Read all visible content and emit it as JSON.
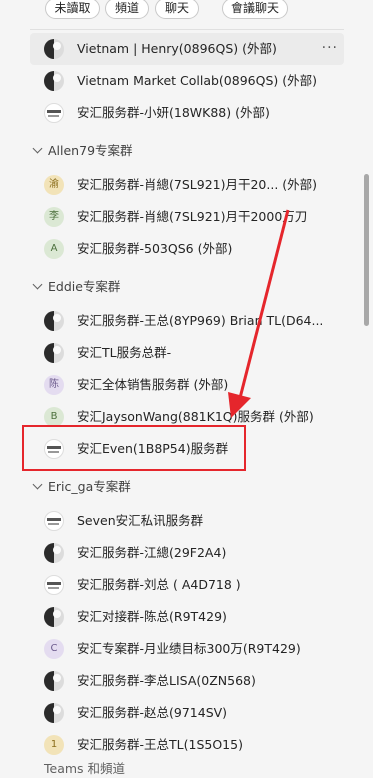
{
  "filters": [
    "未讀取",
    "頻道",
    "聊天",
    "會議聊天"
  ],
  "pinned": [
    {
      "label": "Vietnam | Henry(0896QS) (外部)",
      "avatar": "dark",
      "hover": true,
      "more": "···"
    },
    {
      "label": "Vietnam Market Collab(0896QS) (外部)",
      "avatar": "dark"
    },
    {
      "label": "安汇服务群-小妍(18WK88) (外部)",
      "avatar": "logo"
    }
  ],
  "groups": [
    {
      "name": "Allen79专案群",
      "items": [
        {
          "label": "安汇服务群-肖總(7SL921)月干20... (外部)",
          "avatar": "yellow",
          "avatar_text": "渝"
        },
        {
          "label": "安汇服务群-肖總(7SL921)月干2000万刀",
          "avatar": "green",
          "avatar_text": "李"
        },
        {
          "label": "安汇服务群-503QS6 (外部)",
          "avatar": "green",
          "avatar_text": "A"
        }
      ]
    },
    {
      "name": "Eddie专案群",
      "items": [
        {
          "label": "安汇服务群-王总(8YP969) Brian TL(D64...",
          "avatar": "dark"
        },
        {
          "label": "安汇TL服务总群-",
          "avatar": "dark"
        },
        {
          "label": "安汇全体销售服务群 (外部)",
          "avatar": "purple",
          "avatar_text": "陈"
        },
        {
          "label": "安汇JaysonWang(881K1Q)服务群 (外部)",
          "avatar": "green",
          "avatar_text": "B"
        },
        {
          "label": "安汇Even(1B8P54)服务群",
          "avatar": "logo"
        }
      ]
    },
    {
      "name": "Eric_ga专案群",
      "items": [
        {
          "label": "Seven安汇私讯服务群",
          "avatar": "logo"
        },
        {
          "label": "安汇服务群-江總(29F2A4)",
          "avatar": "dark"
        },
        {
          "label": "安汇服务群-刘总 ( A4D718 )",
          "avatar": "logo"
        },
        {
          "label": "安汇对接群-陈总(R9T429)",
          "avatar": "dark"
        },
        {
          "label": "安汇专案群-月业绩目标300万(R9T429)",
          "avatar": "purple",
          "avatar_text": "C"
        },
        {
          "label": "安汇服务群-李总LISA(0ZN568)",
          "avatar": "dark"
        },
        {
          "label": "安汇服务群-赵总(9714SV)",
          "avatar": "dark"
        },
        {
          "label": "安汇服务群-王总TL(1S5O15)",
          "avatar": "yellow",
          "avatar_text": "1"
        }
      ]
    }
  ],
  "footer_section": "Teams 和頻道"
}
